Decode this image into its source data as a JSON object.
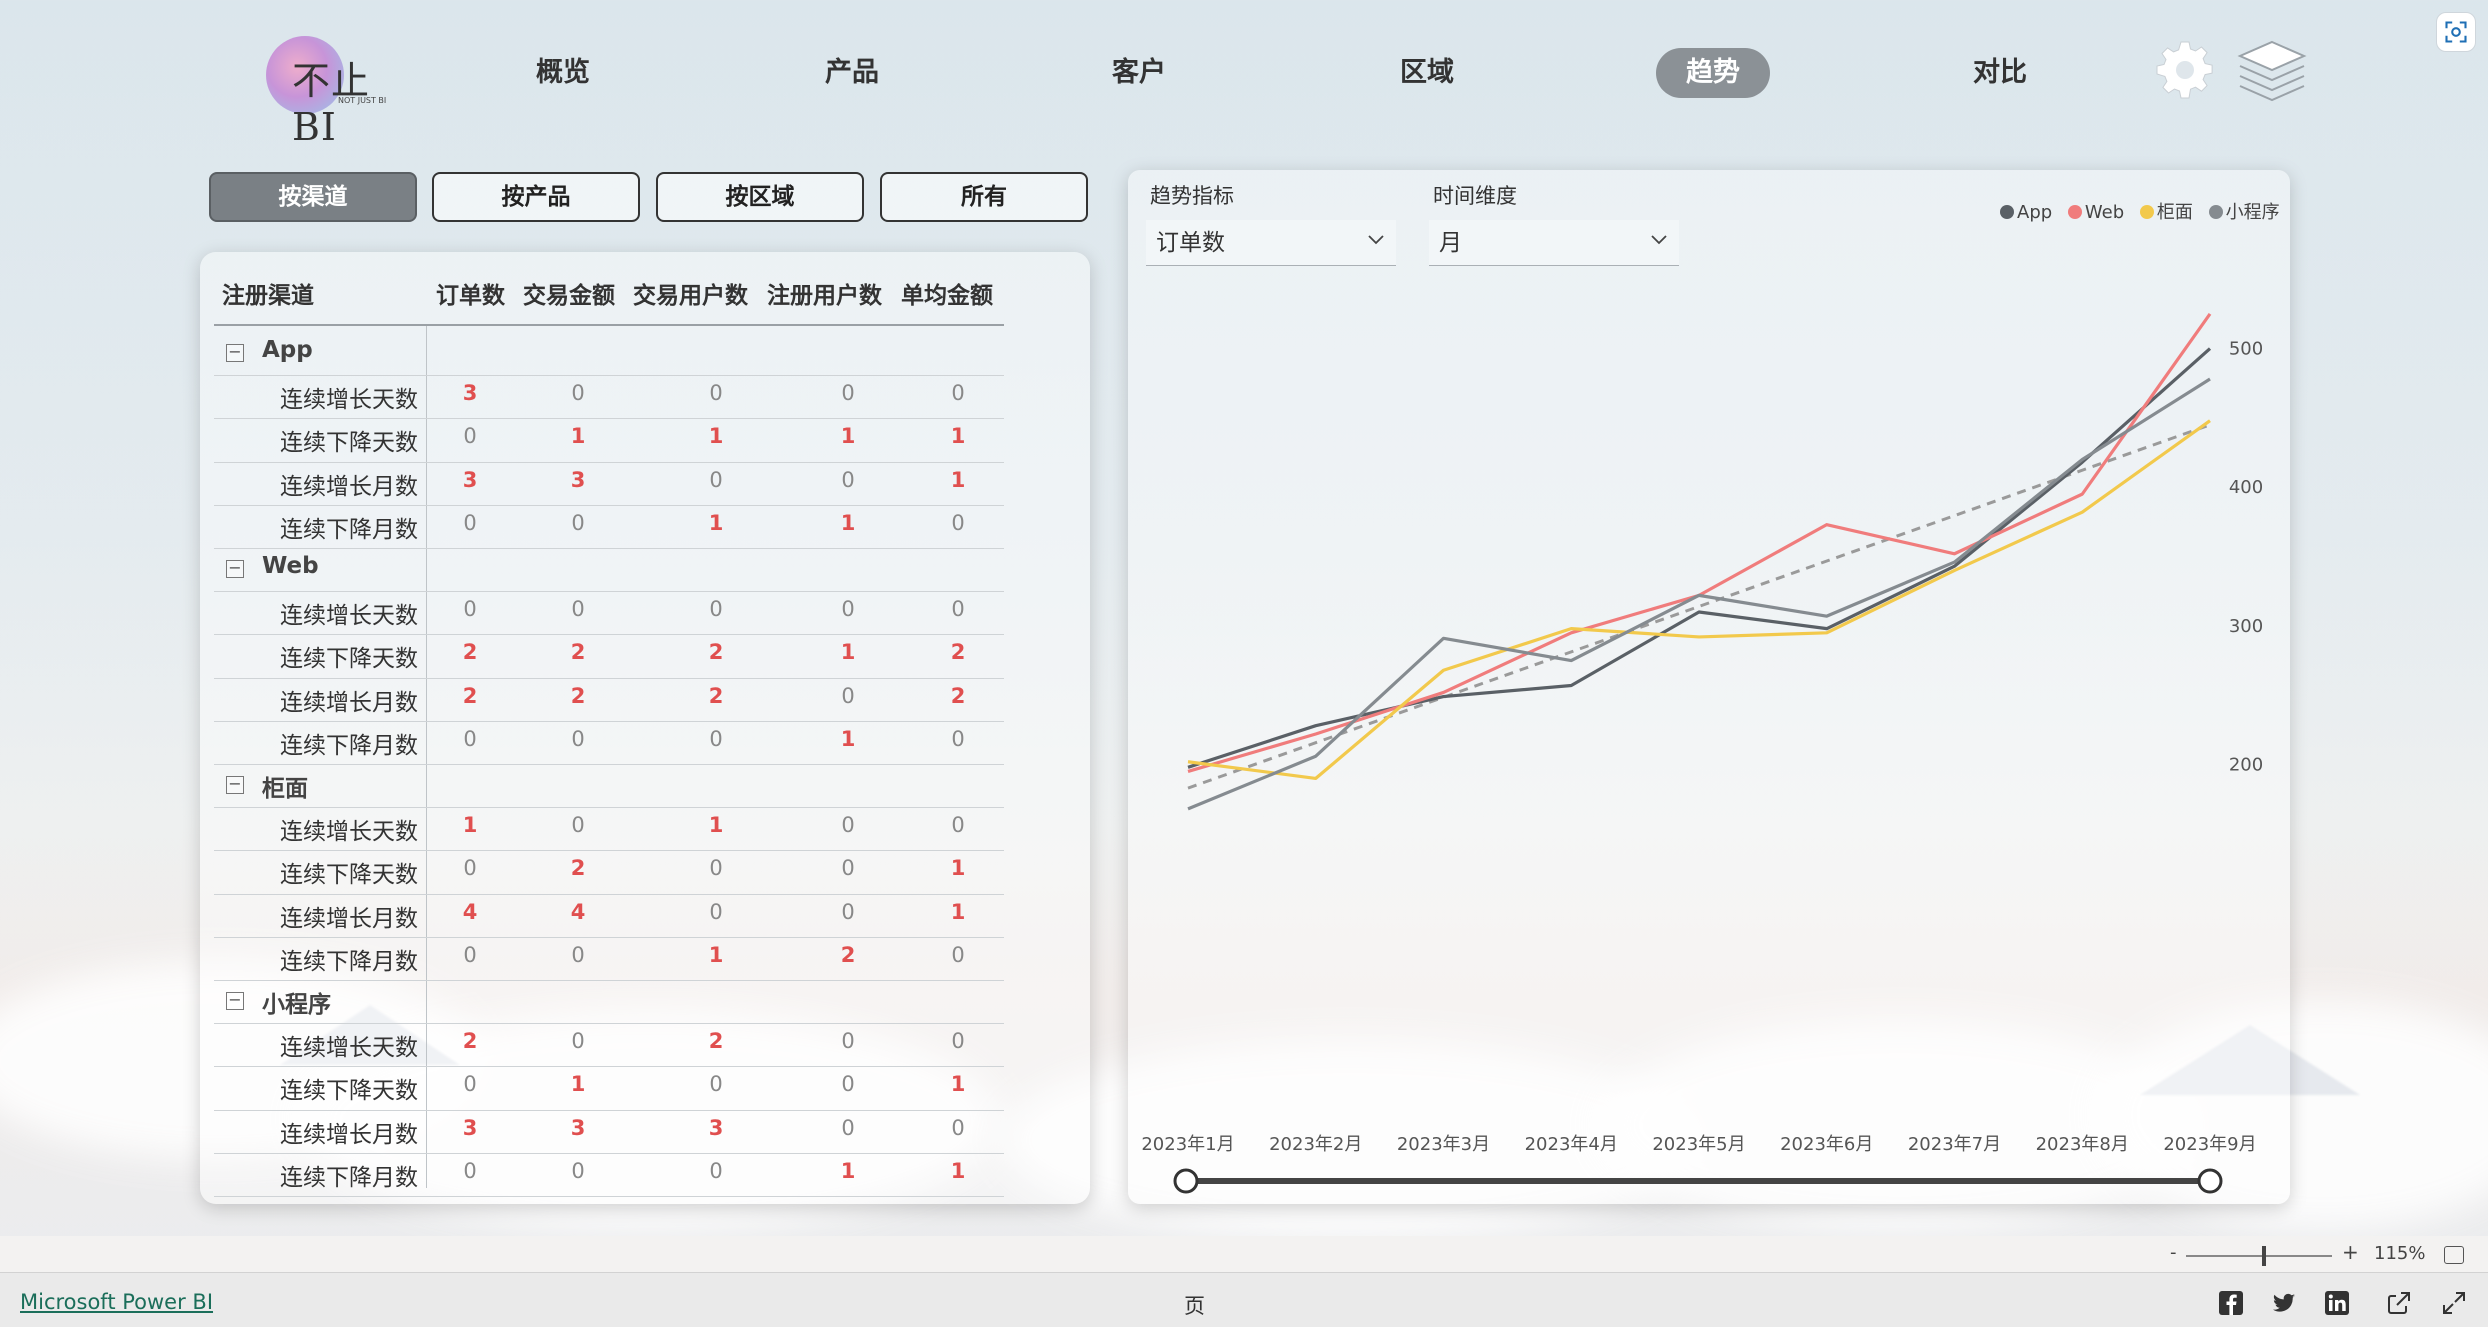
{
  "logo": {
    "text": "不止BI",
    "sub": "NOT JUST BI"
  },
  "nav": [
    {
      "label": "概览",
      "active": false
    },
    {
      "label": "产品",
      "active": false
    },
    {
      "label": "客户",
      "active": false
    },
    {
      "label": "区域",
      "active": false
    },
    {
      "label": "趋势",
      "active": true
    },
    {
      "label": "对比",
      "active": false
    }
  ],
  "filters": [
    {
      "label": "按渠道",
      "active": true
    },
    {
      "label": "按产品",
      "active": false
    },
    {
      "label": "按区域",
      "active": false
    },
    {
      "label": "所有",
      "active": false
    }
  ],
  "matrix": {
    "headers": [
      "注册渠道",
      "订单数",
      "交易金额",
      "交易用户数",
      "注册用户数",
      "单均金额"
    ],
    "groups": [
      {
        "name": "App",
        "toggle": "−",
        "rows": [
          {
            "label": "连续增长天数",
            "values": [
              3,
              0,
              0,
              0,
              0
            ]
          },
          {
            "label": "连续下降天数",
            "values": [
              0,
              1,
              1,
              1,
              1
            ]
          },
          {
            "label": "连续增长月数",
            "values": [
              3,
              3,
              0,
              0,
              1
            ]
          },
          {
            "label": "连续下降月数",
            "values": [
              0,
              0,
              1,
              1,
              0
            ]
          }
        ]
      },
      {
        "name": "Web",
        "toggle": "−",
        "rows": [
          {
            "label": "连续增长天数",
            "values": [
              0,
              0,
              0,
              0,
              0
            ]
          },
          {
            "label": "连续下降天数",
            "values": [
              2,
              2,
              2,
              1,
              2
            ]
          },
          {
            "label": "连续增长月数",
            "values": [
              2,
              2,
              2,
              0,
              2
            ]
          },
          {
            "label": "连续下降月数",
            "values": [
              0,
              0,
              0,
              1,
              0
            ]
          }
        ]
      },
      {
        "name": "柜面",
        "toggle": "−",
        "rows": [
          {
            "label": "连续增长天数",
            "values": [
              1,
              0,
              1,
              0,
              0
            ]
          },
          {
            "label": "连续下降天数",
            "values": [
              0,
              2,
              0,
              0,
              1
            ]
          },
          {
            "label": "连续增长月数",
            "values": [
              4,
              4,
              0,
              0,
              1
            ]
          },
          {
            "label": "连续下降月数",
            "values": [
              0,
              0,
              1,
              2,
              0
            ]
          }
        ]
      },
      {
        "name": "小程序",
        "toggle": "−",
        "rows": [
          {
            "label": "连续增长天数",
            "values": [
              2,
              0,
              2,
              0,
              0
            ]
          },
          {
            "label": "连续下降天数",
            "values": [
              0,
              1,
              0,
              0,
              1
            ]
          },
          {
            "label": "连续增长月数",
            "values": [
              3,
              3,
              3,
              0,
              0
            ]
          },
          {
            "label": "连续下降月数",
            "values": [
              0,
              0,
              0,
              1,
              1
            ]
          }
        ]
      }
    ]
  },
  "slicers": {
    "metric": {
      "label": "趋势指标",
      "value": "订单数"
    },
    "time": {
      "label": "时间维度",
      "value": "月"
    }
  },
  "colors": {
    "app": "#5a6066",
    "web": "#f07c7c",
    "counter": "#f2c94c",
    "mini": "#858b90",
    "trend": "#9a9a9a"
  },
  "chart_data": {
    "type": "line",
    "x": [
      "2023年1月",
      "2023年2月",
      "2023年3月",
      "2023年4月",
      "2023年5月",
      "2023年6月",
      "2023年7月",
      "2023年8月",
      "2023年9月"
    ],
    "yticks": [
      200,
      300,
      400,
      500
    ],
    "ylim": [
      160,
      535
    ],
    "series": [
      {
        "name": "App",
        "values": [
          198,
          228,
          249,
          257,
          310,
          298,
          343,
          418,
          500
        ]
      },
      {
        "name": "Web",
        "values": [
          195,
          222,
          252,
          295,
          322,
          373,
          352,
          395,
          525
        ]
      },
      {
        "name": "柜面",
        "values": [
          202,
          190,
          268,
          298,
          292,
          295,
          340,
          382,
          448
        ]
      },
      {
        "name": "小程序",
        "values": [
          168,
          206,
          291,
          275,
          322,
          307,
          346,
          420,
          478
        ]
      }
    ],
    "trendline": {
      "values": [
        183,
        445
      ]
    },
    "legend": "top-right",
    "grid": false
  },
  "footer": {
    "link": "Microsoft Power BI",
    "page": "页",
    "zoom_minus": "-",
    "zoom_plus": "+",
    "zoom": "115%"
  }
}
